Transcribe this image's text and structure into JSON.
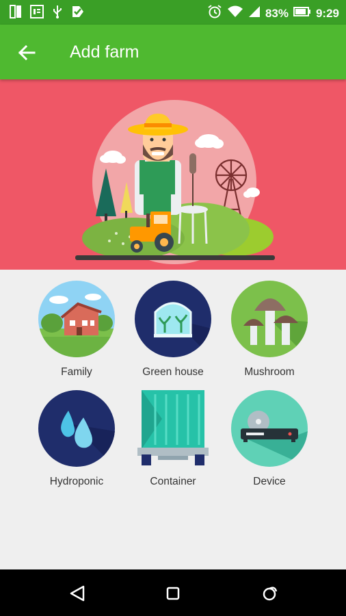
{
  "status_bar": {
    "battery_text": "83%",
    "time": "9:29",
    "left_icons": [
      "notification-app-icon",
      "notification-news-icon",
      "usb-icon",
      "notification-check-icon"
    ],
    "right_icons": [
      "alarm-icon",
      "wifi-icon",
      "signal-icon",
      "battery-icon"
    ]
  },
  "app_bar": {
    "title": "Add farm",
    "back_icon": "arrow-left-icon"
  },
  "hero": {
    "illustration": "farmer-illustration"
  },
  "farm_types": [
    {
      "label": "Family",
      "icon": "family-house-icon"
    },
    {
      "label": "Green house",
      "icon": "greenhouse-icon"
    },
    {
      "label": "Mushroom",
      "icon": "mushroom-icon"
    },
    {
      "label": "Hydroponic",
      "icon": "water-drops-icon"
    },
    {
      "label": "Container",
      "icon": "container-truck-icon"
    },
    {
      "label": "Device",
      "icon": "device-icon"
    }
  ],
  "nav_bar": {
    "buttons": [
      "back-triangle-icon",
      "home-square-icon",
      "recents-icon"
    ]
  },
  "colors": {
    "status_bar": "#3a9f26",
    "app_bar": "#4fb930",
    "hero_bg": "#ef5766",
    "content_bg": "#efefef"
  }
}
